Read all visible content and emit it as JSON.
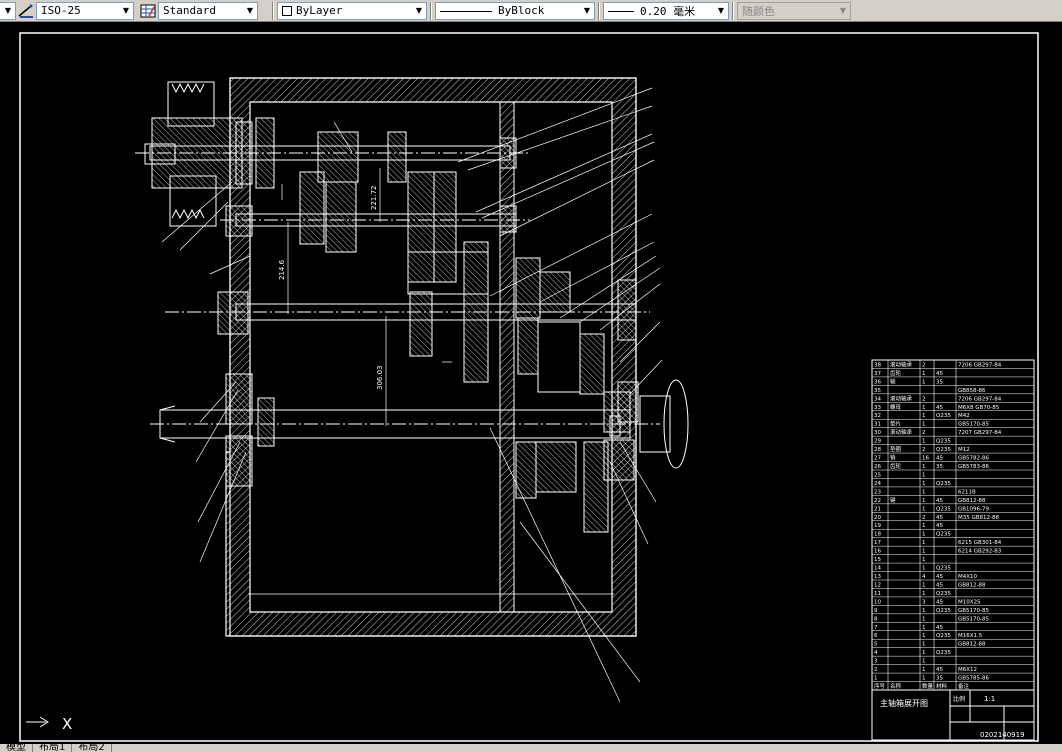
{
  "toolbar": {
    "dimstyle": "ISO-25",
    "tablestyle": "Standard",
    "layer": "ByLayer",
    "linetype": "ByBlock",
    "lineweight": "0.20 毫米",
    "color": "随颜色"
  },
  "drawing": {
    "title": "主轴箱展开图",
    "scale_label": "比例",
    "scale": "1:1",
    "drawing_no": "0202140919",
    "dims": [
      "221.72",
      "214.6",
      "306.03"
    ],
    "bom": [
      {
        "no": "38",
        "name": "滚动轴承",
        "qty": "2",
        "mat": "",
        "spec": "7206 GB297-84"
      },
      {
        "no": "37",
        "name": "齿轮",
        "qty": "1",
        "mat": "45",
        "spec": ""
      },
      {
        "no": "36",
        "name": "轴",
        "qty": "1",
        "mat": "35",
        "spec": ""
      },
      {
        "no": "35",
        "name": "",
        "qty": "",
        "mat": "",
        "spec": "GB858-86"
      },
      {
        "no": "34",
        "name": "滚动轴承",
        "qty": "2",
        "mat": "",
        "spec": "7206 GB297-84"
      },
      {
        "no": "33",
        "name": "螺母",
        "qty": "1",
        "mat": "45",
        "spec": "M6X8 GB70-85"
      },
      {
        "no": "32",
        "name": "",
        "qty": "1",
        "mat": "Q235",
        "spec": "M42"
      },
      {
        "no": "31",
        "name": "垫片",
        "qty": "1",
        "mat": "",
        "spec": "GB5170-85"
      },
      {
        "no": "30",
        "name": "滚动轴承",
        "qty": "2",
        "mat": "",
        "spec": "7207 GB297-84"
      },
      {
        "no": "29",
        "name": "",
        "qty": "1",
        "mat": "Q235",
        "spec": ""
      },
      {
        "no": "28",
        "name": "垫圈",
        "qty": "2",
        "mat": "Q235",
        "spec": "M12"
      },
      {
        "no": "27",
        "name": "销",
        "qty": "16",
        "mat": "45",
        "spec": "GB5782-86"
      },
      {
        "no": "26",
        "name": "齿轮",
        "qty": "1",
        "mat": "35",
        "spec": "GB5783-86"
      },
      {
        "no": "25",
        "name": "",
        "qty": "1",
        "mat": "",
        "spec": ""
      },
      {
        "no": "24",
        "name": "",
        "qty": "1",
        "mat": "Q235",
        "spec": ""
      },
      {
        "no": "23",
        "name": "",
        "qty": "1",
        "mat": "",
        "spec": "6211B"
      },
      {
        "no": "22",
        "name": "键",
        "qty": "1",
        "mat": "45",
        "spec": "GB812-88"
      },
      {
        "no": "21",
        "name": "",
        "qty": "1",
        "mat": "Q235",
        "spec": "GB1096-79"
      },
      {
        "no": "20",
        "name": "",
        "qty": "2",
        "mat": "45",
        "spec": "M35 GB812-88"
      },
      {
        "no": "19",
        "name": "",
        "qty": "1",
        "mat": "45",
        "spec": ""
      },
      {
        "no": "18",
        "name": "",
        "qty": "1",
        "mat": "Q235",
        "spec": ""
      },
      {
        "no": "17",
        "name": "",
        "qty": "1",
        "mat": "",
        "spec": "6215 GB301-84"
      },
      {
        "no": "16",
        "name": "",
        "qty": "1",
        "mat": "",
        "spec": "6214 GB292-83"
      },
      {
        "no": "15",
        "name": "",
        "qty": "1",
        "mat": "",
        "spec": ""
      },
      {
        "no": "14",
        "name": "",
        "qty": "1",
        "mat": "Q235",
        "spec": ""
      },
      {
        "no": "13",
        "name": "",
        "qty": "4",
        "mat": "45",
        "spec": "M4X10"
      },
      {
        "no": "12",
        "name": "",
        "qty": "1",
        "mat": "45",
        "spec": "GB812-88"
      },
      {
        "no": "11",
        "name": "",
        "qty": "1",
        "mat": "Q235",
        "spec": ""
      },
      {
        "no": "10",
        "name": "",
        "qty": "3",
        "mat": "45",
        "spec": "M10X25"
      },
      {
        "no": "9",
        "name": "",
        "qty": "1",
        "mat": "Q235",
        "spec": "GB5170-85"
      },
      {
        "no": "8",
        "name": "",
        "qty": "1",
        "mat": "",
        "spec": "GB5170-85"
      },
      {
        "no": "7",
        "name": "",
        "qty": "1",
        "mat": "45",
        "spec": ""
      },
      {
        "no": "6",
        "name": "",
        "qty": "1",
        "mat": "Q235",
        "spec": "M16X1.5"
      },
      {
        "no": "5",
        "name": "",
        "qty": "1",
        "mat": "",
        "spec": "GB812-88"
      },
      {
        "no": "4",
        "name": "",
        "qty": "1",
        "mat": "Q235",
        "spec": ""
      },
      {
        "no": "3",
        "name": "",
        "qty": "1",
        "mat": "",
        "spec": ""
      },
      {
        "no": "2",
        "name": "",
        "qty": "1",
        "mat": "45",
        "spec": "M6X12"
      },
      {
        "no": "1",
        "name": "",
        "qty": "1",
        "mat": "35",
        "spec": "GB5785-86"
      }
    ],
    "bom_header": {
      "no": "序号",
      "name": "名称",
      "qty": "数量",
      "mat": "材料",
      "spec": "备注"
    },
    "ucs_label": "X"
  },
  "tabs": [
    "模型",
    "布局1",
    "布局2"
  ],
  "colors": {
    "background": "#000000",
    "line": "#ffffff",
    "toolbar": "#d4d0c8"
  }
}
